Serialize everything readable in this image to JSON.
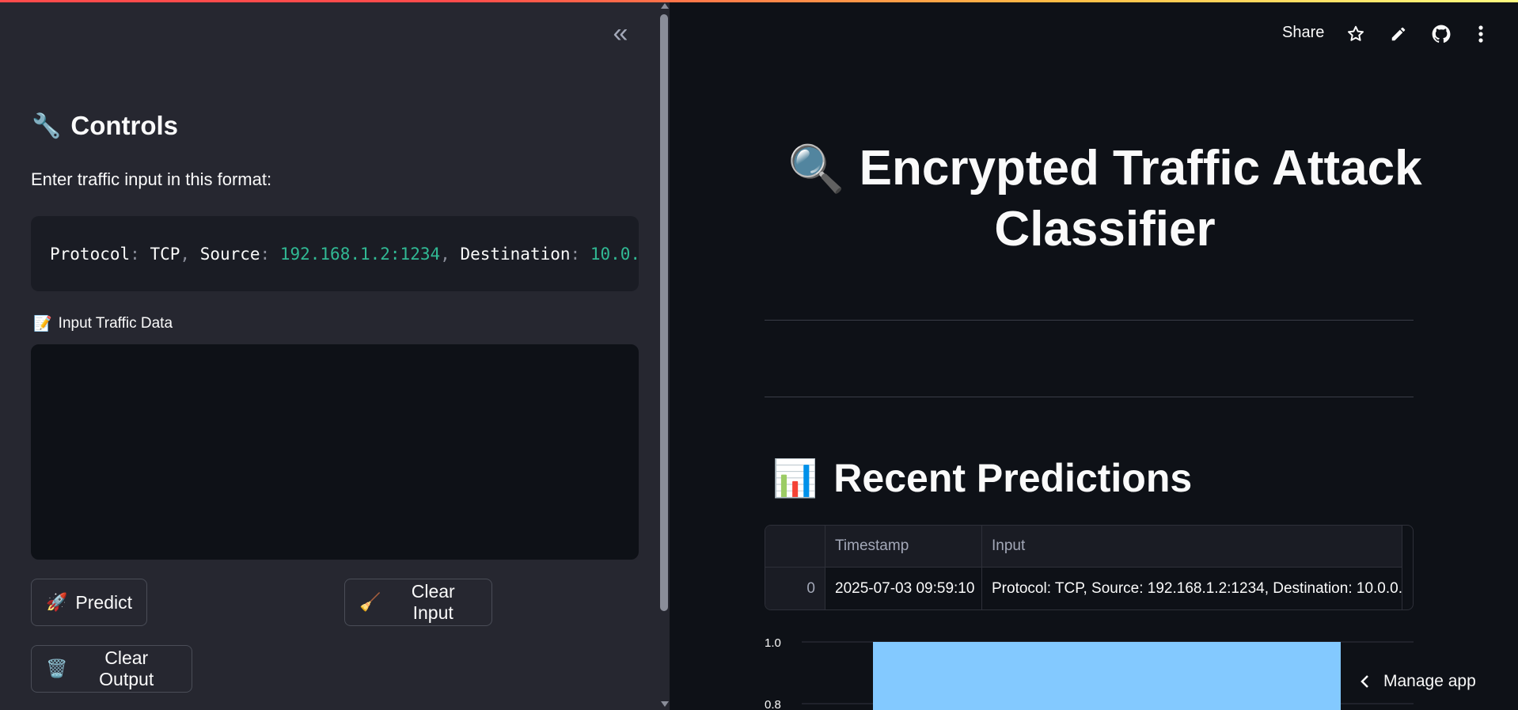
{
  "sidebar": {
    "collapse_glyph": "«",
    "heading_emoji": "🔧",
    "heading": "Controls",
    "instruction": "Enter traffic input in this format:",
    "code_parts": [
      {
        "t": "Protocol",
        "c": "k"
      },
      {
        "t": ": ",
        "c": "p"
      },
      {
        "t": "TCP",
        "c": "k"
      },
      {
        "t": ", ",
        "c": "p"
      },
      {
        "t": "Source",
        "c": "k"
      },
      {
        "t": ": ",
        "c": "p"
      },
      {
        "t": "192.168.1.2:1234",
        "c": "v"
      },
      {
        "t": ", ",
        "c": "p"
      },
      {
        "t": "Destination",
        "c": "k"
      },
      {
        "t": ": ",
        "c": "p"
      },
      {
        "t": "10.0.",
        "c": "v"
      }
    ],
    "input_label_emoji": "📝",
    "input_label": "Input Traffic Data",
    "input_value": "",
    "buttons": {
      "predict_emoji": "🚀",
      "predict": "Predict",
      "clear_input_emoji": "🧹",
      "clear_input": "Clear Input",
      "clear_output_emoji": "🗑️",
      "clear_output": "Clear Output"
    }
  },
  "toolbar": {
    "share": "Share",
    "icons": [
      "star-icon",
      "pencil-icon",
      "github-icon",
      "more-vertical-icon"
    ]
  },
  "main": {
    "title_emoji": "🔍",
    "title_line1": "Encrypted Traffic Attack",
    "title_line2": "Classifier",
    "section_emoji": "📊",
    "section_title": "Recent Predictions",
    "table": {
      "columns": [
        "",
        "Timestamp",
        "Input"
      ],
      "rows": [
        {
          "index": "0",
          "timestamp": "2025-07-03 09:59:10",
          "input": "Protocol: TCP, Source: 192.168.1.2:1234, Destination: 10.0.0."
        }
      ]
    }
  },
  "chart_data": {
    "type": "bar",
    "ytick_labels": [
      "1.0",
      "0.8"
    ],
    "values": [
      1.0
    ],
    "bar_color": "#83c9ff",
    "ylim_visible": [
      0.8,
      1.0
    ]
  },
  "manage_app": "Manage app"
}
